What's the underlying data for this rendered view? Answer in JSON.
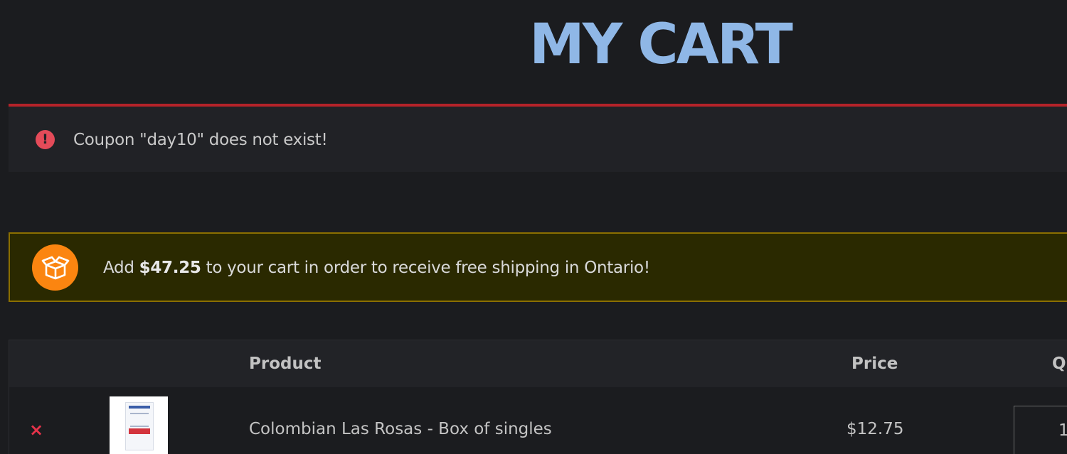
{
  "page": {
    "title": "MY CART"
  },
  "error_notice": {
    "icon": "alert-circle-icon",
    "message": "Coupon \"day10\" does not exist!",
    "accent_color": "#b52329"
  },
  "shipping_notice": {
    "icon": "open-box-icon",
    "prefix": "Add ",
    "amount": "$47.25",
    "suffix": " to your cart in order to receive free shipping in Ontario!",
    "icon_color": "#fb8510"
  },
  "cart_table": {
    "headers": {
      "product": "Product",
      "price": "Price",
      "quantity": "Q"
    },
    "rows": [
      {
        "remove_icon": "×",
        "product_name": "Colombian Las Rosas - Box of singles",
        "price": "$12.75",
        "quantity": "1"
      }
    ]
  }
}
